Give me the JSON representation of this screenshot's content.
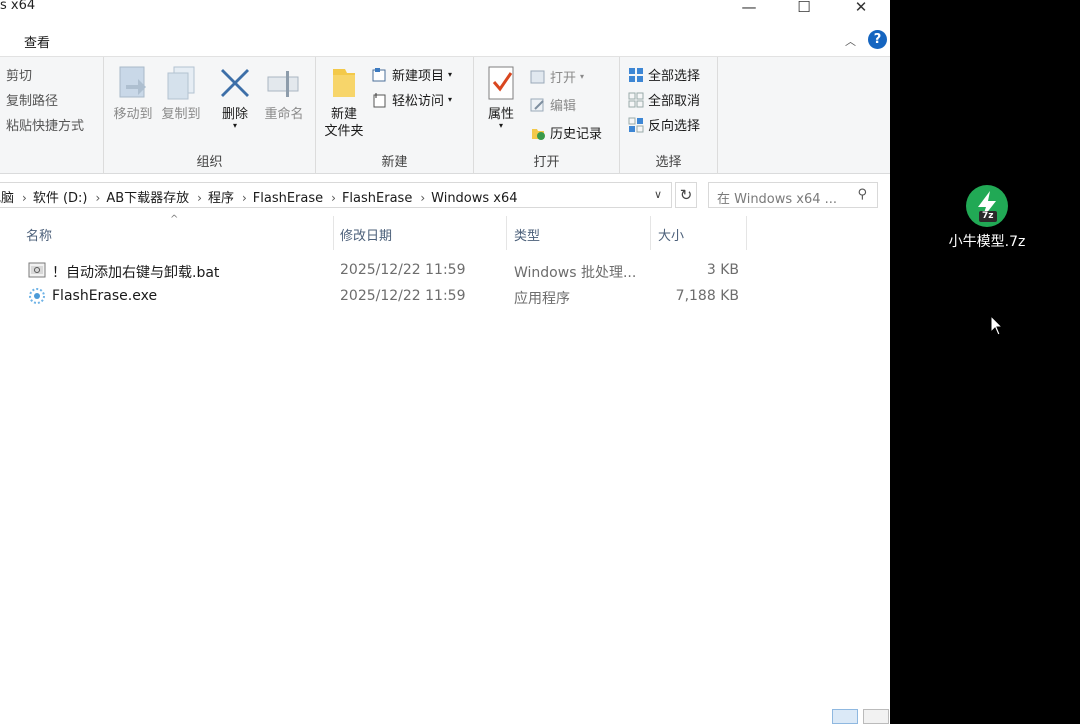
{
  "window": {
    "title": "s x64",
    "tab_view": "查看"
  },
  "ribbon": {
    "clipboard": {
      "cut": "剪切",
      "copy_path": "复制路径",
      "paste_shortcut": "粘贴快捷方式"
    },
    "organize": {
      "move_to": "移动到",
      "copy_to": "复制到",
      "delete": "删除",
      "rename": "重命名",
      "label": "组织"
    },
    "new": {
      "new_folder_line1": "新建",
      "new_folder_line2": "文件夹",
      "new_item": "新建项目",
      "easy_access": "轻松访问",
      "label": "新建"
    },
    "open": {
      "properties": "属性",
      "open": "打开",
      "edit": "编辑",
      "history": "历史记录",
      "label": "打开"
    },
    "select": {
      "select_all": "全部选择",
      "select_none": "全部取消",
      "invert": "反向选择",
      "label": "选择"
    }
  },
  "address": {
    "crumbs": [
      "电脑",
      "软件 (D:)",
      "AB下载器存放",
      "程序",
      "FlashErase",
      "FlashErase",
      "Windows x64"
    ],
    "search_placeholder": "在 Windows x64 ..."
  },
  "columns": {
    "name": "名称",
    "modified": "修改日期",
    "type": "类型",
    "size": "大小"
  },
  "files": [
    {
      "name": "！自动添加右键与卸载.bat",
      "modified": "2025/12/22 11:59",
      "type": "Windows 批处理...",
      "size": "3 KB",
      "icon": "bat-file-icon"
    },
    {
      "name": "FlashErase.exe",
      "modified": "2025/12/22 11:59",
      "type": "应用程序",
      "size": "7,188 KB",
      "icon": "exe-file-icon"
    }
  ],
  "desktop": {
    "icon_label": "小牛模型.7z",
    "icon_tag": "7z"
  },
  "colors": {
    "accent": "#1565c0",
    "desktop_bg": "#000000",
    "archive_green": "#21a955"
  }
}
